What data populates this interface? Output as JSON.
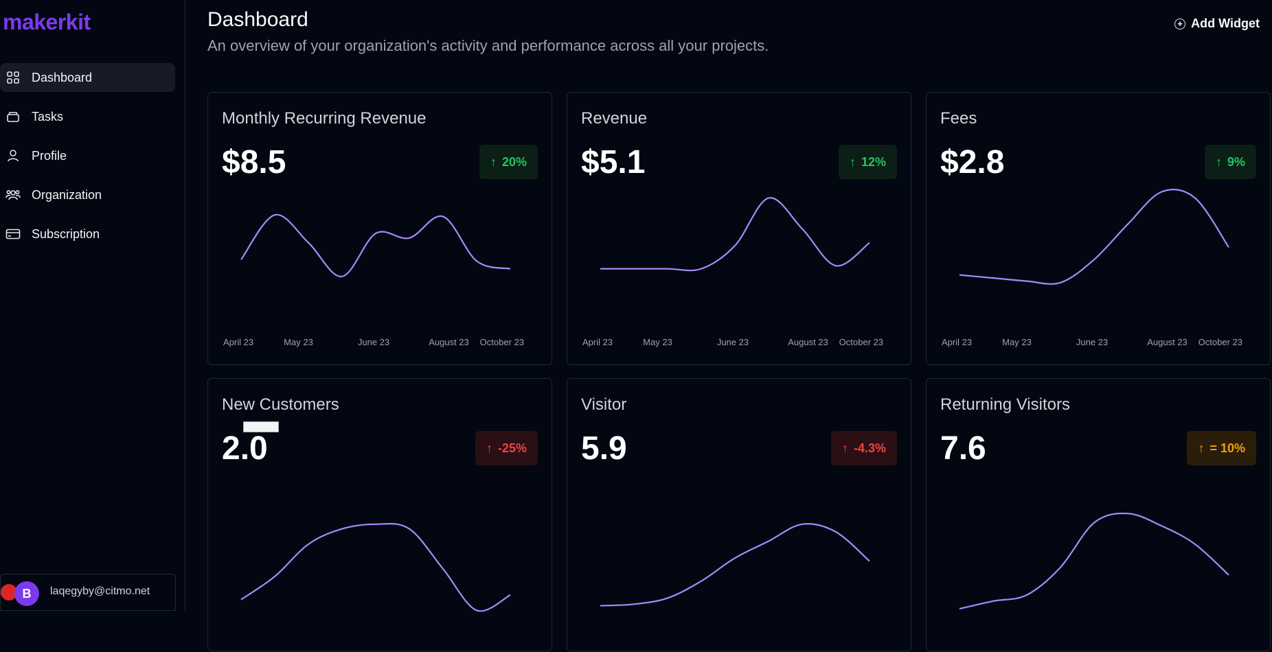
{
  "sidebar": {
    "logo": "makerkit",
    "items": [
      {
        "label": "Dashboard",
        "icon": "grid-icon",
        "active": true
      },
      {
        "label": "Tasks",
        "icon": "layers-icon",
        "active": false
      },
      {
        "label": "Profile",
        "icon": "user-icon",
        "active": false
      },
      {
        "label": "Organization",
        "icon": "users-icon",
        "active": false
      },
      {
        "label": "Subscription",
        "icon": "credit-card-icon",
        "active": false
      }
    ],
    "account": {
      "avatar_initial": "B",
      "email": "laqegyby@citmo.net"
    }
  },
  "header": {
    "title": "Dashboard",
    "subtitle": "An overview of your organization's activity and performance across all your projects.",
    "add_widget_label": "Add Widget"
  },
  "colors": {
    "background": "#030712",
    "brand": "#7c3aed",
    "line": "#a78bfa",
    "trend_up": "#22c55e",
    "trend_down": "#ef4444",
    "trend_stale": "#f59e0b"
  },
  "cards": [
    {
      "title": "Monthly Recurring Revenue",
      "value": "$8.5",
      "trend": "20%",
      "trend_type": "up"
    },
    {
      "title": "Revenue",
      "value": "$5.1",
      "trend": "12%",
      "trend_type": "up"
    },
    {
      "title": "Fees",
      "value": "$2.8",
      "trend": "9%",
      "trend_type": "up"
    },
    {
      "title": "New Customers",
      "value": "2.0",
      "trend": "-25%",
      "trend_type": "down"
    },
    {
      "title": "Visitor",
      "value": "5.9",
      "trend": "-4.3%",
      "trend_type": "down"
    },
    {
      "title": "Returning Visitors",
      "value": "7.6",
      "trend": "= 10%",
      "trend_type": "stale"
    }
  ],
  "chart_data": [
    {
      "type": "line",
      "x": [
        "April 23",
        "May 23",
        "June 23",
        "August 23",
        "October 23"
      ],
      "series": [
        {
          "values": [
            4.5,
            7.4,
            5.6,
            3.4,
            6.2,
            5.9,
            7.3,
            4.4,
            3.9
          ]
        }
      ]
    },
    {
      "type": "line",
      "x": [
        "April 23",
        "May 23",
        "June 23",
        "August 23",
        "October 23"
      ],
      "series": [
        {
          "values": [
            3.9,
            3.9,
            3.9,
            3.9,
            5.4,
            8.5,
            6.5,
            4.1,
            5.6
          ]
        }
      ]
    },
    {
      "type": "line",
      "x": [
        "April 23",
        "May 23",
        "June 23",
        "August 23",
        "October 23"
      ],
      "series": [
        {
          "values": [
            3.5,
            3.3,
            3.1,
            3.0,
            4.5,
            6.8,
            8.9,
            8.5,
            5.3
          ]
        }
      ]
    },
    {
      "type": "line",
      "x": [],
      "series": [
        {
          "values": [
            1.0,
            2.5,
            4.6,
            5.6,
            5.9,
            5.6,
            3.0,
            0.3,
            1.3
          ]
        }
      ]
    },
    {
      "type": "line",
      "x": [],
      "series": [
        {
          "values": [
            0.6,
            0.7,
            1.1,
            2.2,
            3.7,
            4.8,
            5.9,
            5.4,
            3.5
          ]
        }
      ]
    },
    {
      "type": "line",
      "x": [],
      "series": [
        {
          "values": [
            0.4,
            0.9,
            1.3,
            3.1,
            6.0,
            6.6,
            5.8,
            4.6,
            2.6
          ]
        }
      ]
    }
  ]
}
